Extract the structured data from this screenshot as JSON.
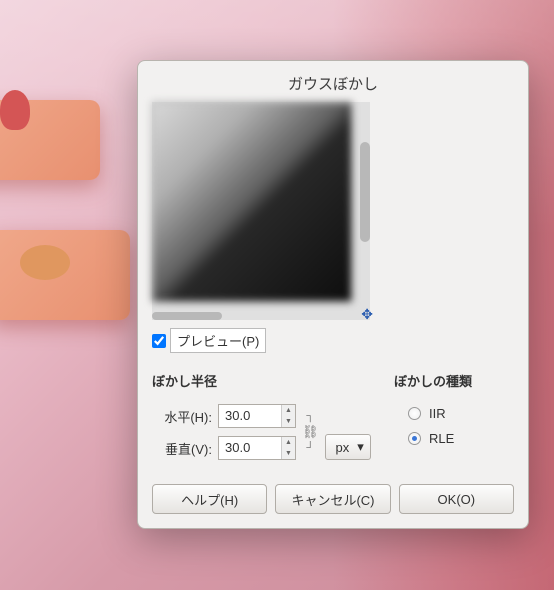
{
  "dialog": {
    "title": "ガウスぼかし",
    "preview_label": "プレビュー(P)",
    "preview_checked": true
  },
  "radius": {
    "section_title": "ぼかし半径",
    "horizontal_label": "水平(H):",
    "horizontal_value": "30.0",
    "vertical_label": "垂直(V):",
    "vertical_value": "30.0",
    "unit": "px"
  },
  "type": {
    "section_title": "ぼかしの種類",
    "options": {
      "iir": "IIR",
      "rle": "RLE"
    },
    "selected": "rle"
  },
  "buttons": {
    "help": "ヘルプ(H)",
    "cancel": "キャンセル(C)",
    "ok": "OK(O)"
  }
}
